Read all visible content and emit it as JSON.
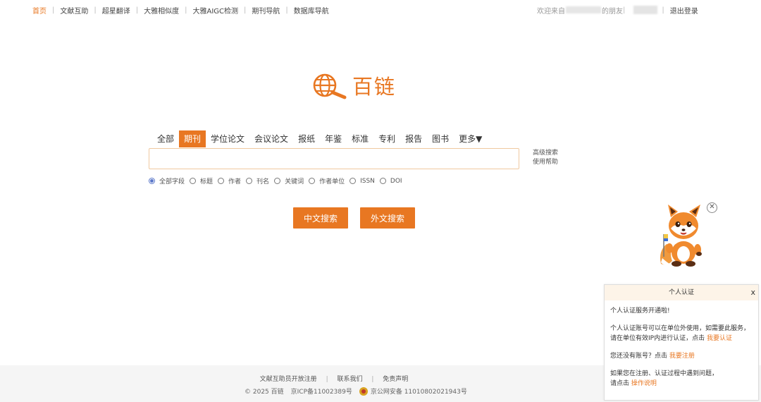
{
  "topnav": {
    "items": [
      "首页",
      "文献互助",
      "超星翻译",
      "大雅相似度",
      "大雅AIGC检测",
      "期刊导航",
      "数据库导航"
    ],
    "active_index": 0,
    "separator": "|"
  },
  "topright": {
    "welcome_prefix": "欢迎来自",
    "welcome_suffix": "的朋友",
    "logout": "退出登录"
  },
  "logo": {
    "text": "百链",
    "color": "#e87722"
  },
  "tabs": {
    "items": [
      "全部",
      "期刊",
      "学位论文",
      "会议论文",
      "报纸",
      "年鉴",
      "标准",
      "专利",
      "报告",
      "图书",
      "更多▼"
    ],
    "active_index": 1
  },
  "search": {
    "value": "",
    "placeholder": ""
  },
  "side_links": {
    "advanced": "高级搜索",
    "help": "使用帮助"
  },
  "fields": {
    "options": [
      "全部字段",
      "标题",
      "作者",
      "刊名",
      "关键词",
      "作者单位",
      "ISSN",
      "DOI"
    ],
    "selected_index": 0
  },
  "buttons": {
    "chinese": "中文搜索",
    "foreign": "外文搜索"
  },
  "footer": {
    "links": [
      "文献互助员开放注册",
      "联系我们",
      "免责声明"
    ],
    "copyright": "© 2025 百链",
    "icp": "京ICP备11002389号",
    "police": "京公网安备 11010802021943号"
  },
  "popup": {
    "title": "个人认证",
    "close": "x",
    "line1": "个人认证服务开通啦!",
    "line2a": "个人认证账号可以在单位外使用，如需要此服务，",
    "line2b": "请在单位有效IP内进行认证，点击",
    "link_verify": "我要认证",
    "line3": "您还没有账号？点击",
    "link_register": "我要注册",
    "line4a": "如果您在注册、认证过程中遇到问题，",
    "line4b": "请点击",
    "link_guide": "操作说明"
  },
  "colors": {
    "accent": "#e87722",
    "radio_checked": "#5a77c9",
    "footer_bg": "#f5f5f5",
    "popup_header_bg": "#fdf4e8"
  }
}
